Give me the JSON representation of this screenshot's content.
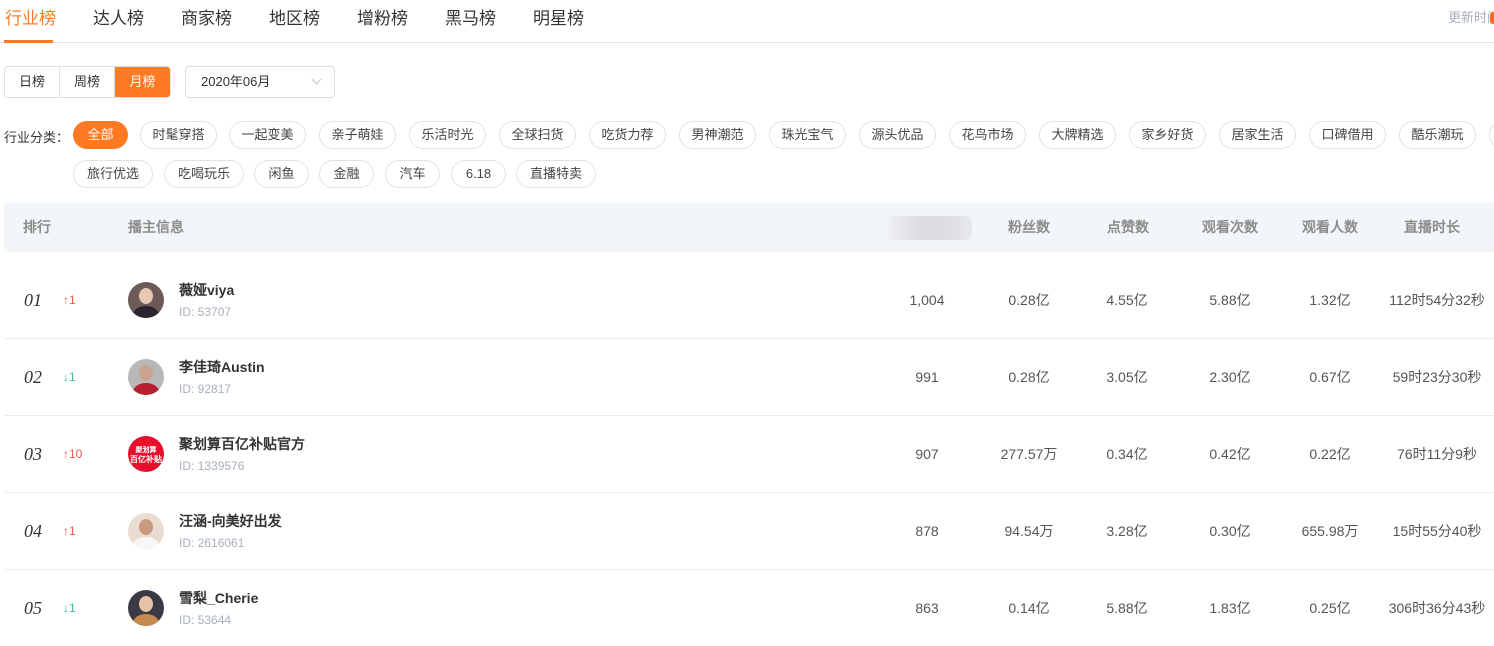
{
  "top_tabs": [
    {
      "label": "行业榜",
      "active": true
    },
    {
      "label": "达人榜",
      "active": false
    },
    {
      "label": "商家榜",
      "active": false
    },
    {
      "label": "地区榜",
      "active": false
    },
    {
      "label": "增粉榜",
      "active": false
    },
    {
      "label": "黑马榜",
      "active": false
    },
    {
      "label": "明星榜",
      "active": false
    }
  ],
  "update_time_label": "更新时间",
  "period": {
    "options": [
      "日榜",
      "周榜",
      "月榜"
    ],
    "selected": "月榜"
  },
  "date_select": {
    "value": "2020年06月",
    "icon": "chevron-down-icon"
  },
  "category": {
    "label": "行业分类：",
    "items": [
      "全部",
      "时髦穿搭",
      "一起变美",
      "亲子萌娃",
      "乐活时光",
      "全球扫货",
      "吃货力荐",
      "男神潮范",
      "珠光宝气",
      "源头优品",
      "花鸟市场",
      "大牌精选",
      "家乡好货",
      "居家生活",
      "口碑借用",
      "酷乐潮玩",
      "旅行优选",
      "吃喝玩乐",
      "闲鱼",
      "金融",
      "汽车",
      "6.18",
      "直播特卖"
    ],
    "selected": "全部"
  },
  "table": {
    "headers": {
      "rank": "排行",
      "anchor": "播主信息",
      "blurred": "",
      "fans": "粉丝数",
      "likes": "点赞数",
      "views": "观看次数",
      "viewers": "观看人数",
      "duration": "直播时长"
    },
    "id_prefix": "ID: ",
    "rows": [
      {
        "rank": "01",
        "change": "↑1",
        "direction": "up",
        "name": "薇娅viya",
        "id": "ID:  53707",
        "score": "1,004",
        "fans": "0.28亿",
        "likes": "4.55亿",
        "views": "5.88亿",
        "viewers": "1.32亿",
        "duration": "112时54分32秒"
      },
      {
        "rank": "02",
        "change": "↓1",
        "direction": "down",
        "name": "李佳琦Austin",
        "id": "ID:  92817",
        "score": "991",
        "fans": "0.28亿",
        "likes": "3.05亿",
        "views": "2.30亿",
        "viewers": "0.67亿",
        "duration": "59时23分30秒"
      },
      {
        "rank": "03",
        "change": "↑10",
        "direction": "up",
        "name": "聚划算百亿补贴官方",
        "id": "ID:  1339576",
        "score": "907",
        "fans": "277.57万",
        "likes": "0.34亿",
        "views": "0.42亿",
        "viewers": "0.22亿",
        "duration": "76时11分9秒",
        "avatar_text_1": "聚划算",
        "avatar_text_2": "百亿补贴"
      },
      {
        "rank": "04",
        "change": "↑1",
        "direction": "up",
        "name": "汪涵-向美好出发",
        "id": "ID:  2616061",
        "score": "878",
        "fans": "94.54万",
        "likes": "3.28亿",
        "views": "0.30亿",
        "viewers": "655.98万",
        "duration": "15时55分40秒"
      },
      {
        "rank": "05",
        "change": "↓1",
        "direction": "down",
        "name": "雪梨_Cherie",
        "id": "ID:  53644",
        "score": "863",
        "fans": "0.14亿",
        "likes": "5.88亿",
        "views": "1.83亿",
        "viewers": "0.25亿",
        "duration": "306时36分43秒"
      }
    ]
  },
  "colors": {
    "accent": "#ff7a22",
    "up": "#f5564b",
    "down": "#39c08a",
    "header_bg": "#f3f6f9"
  }
}
